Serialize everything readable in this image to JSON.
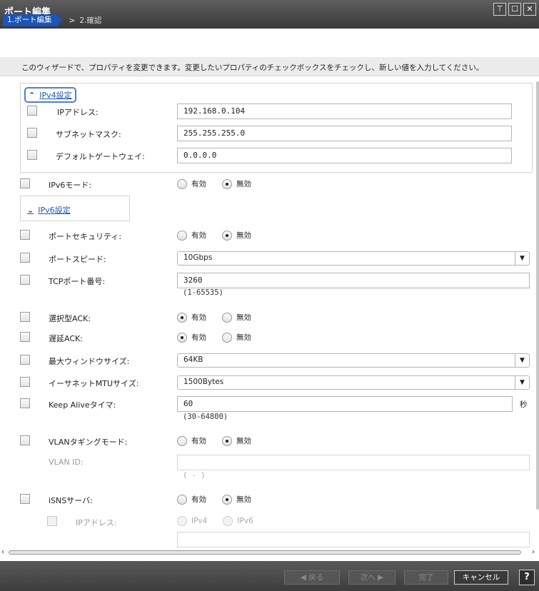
{
  "window": {
    "title": "ポート編集",
    "pin_icon": "pin-icon",
    "maximize_icon": "maximize-icon",
    "close_icon": "close-icon"
  },
  "breadcrumb": {
    "step1": "1.ポート編集",
    "separator": ">",
    "step2": "2.確認"
  },
  "description": "このウィザードで、プロパティを変更できます。変更したいプロパティのチェックボックスをチェックし、新しい値を入力してください。",
  "ipv4_section": {
    "label": "IPv4設定",
    "ip_address_label": "IPアドレス:",
    "ip_address_value": "192.168.0.104",
    "subnet_label": "サブネットマスク:",
    "subnet_value": "255.255.255.0",
    "gateway_label": "デフォルトゲートウェイ:",
    "gateway_value": "0.0.0.0"
  },
  "ipv6_mode": {
    "label": "IPv6モード:",
    "on": "有効",
    "off": "無効",
    "selected": "off"
  },
  "ipv6_section": {
    "label": "IPv6設定"
  },
  "port_security": {
    "label": "ポートセキュリティ:",
    "on": "有効",
    "off": "無効",
    "selected": "off"
  },
  "port_speed": {
    "label": "ポートスピード:",
    "value": "10Gbps"
  },
  "tcp_port": {
    "label": "TCPポート番号:",
    "value": "3260",
    "range": "(1-65535)"
  },
  "selective_ack": {
    "label": "選択型ACK:",
    "on": "有効",
    "off": "無効",
    "selected": "on"
  },
  "delayed_ack": {
    "label": "遅延ACK:",
    "on": "有効",
    "off": "無効",
    "selected": "on"
  },
  "max_window": {
    "label": "最大ウィンドウサイズ:",
    "value": "64KB"
  },
  "ethernet_mtu": {
    "label": "イーサネットMTUサイズ:",
    "value": "1500Bytes"
  },
  "keep_alive": {
    "label": "Keep Aliveタイマ:",
    "value": "60",
    "unit": "秒",
    "range": "(30-64800)"
  },
  "vlan_tagging": {
    "label": "VLANタギングモード:",
    "on": "有効",
    "off": "無効",
    "selected": "off"
  },
  "vlan_id": {
    "label": "VLAN ID:",
    "value": "",
    "range": "( - )"
  },
  "isns_server": {
    "label": "iSNSサーバ:",
    "on": "有効",
    "off": "無効",
    "selected": "off"
  },
  "isns_ip": {
    "label": "IPアドレス:",
    "opt1": "IPv4",
    "opt2": "IPv6",
    "value": ""
  },
  "footer": {
    "back": "◀ 戻る",
    "next": "次へ ▶",
    "finish": "完了",
    "cancel": "キャンセル",
    "help": "?"
  }
}
